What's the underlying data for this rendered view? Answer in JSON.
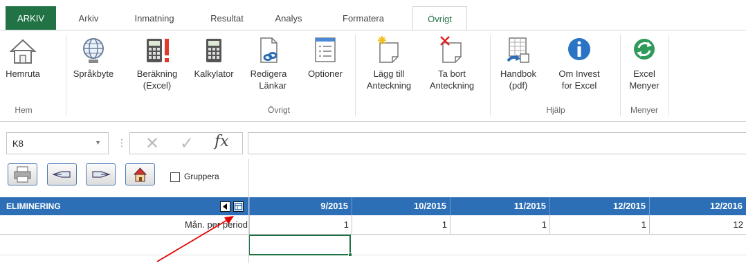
{
  "tabs": [
    "ARKIV",
    "Arkiv",
    "Inmatning",
    "Resultat",
    "Analys",
    "Formatera",
    "Övrigt"
  ],
  "ribbon": {
    "buttons": [
      {
        "line1": "Hemruta",
        "line2": ""
      },
      {
        "line1": "Språkbyte",
        "line2": ""
      },
      {
        "line1": "Beräkning",
        "line2": "(Excel)"
      },
      {
        "line1": "Kalkylator",
        "line2": ""
      },
      {
        "line1": "Redigera",
        "line2": "Länkar"
      },
      {
        "line1": "Optioner",
        "line2": ""
      },
      {
        "line1": "Lägg till",
        "line2": "Anteckning"
      },
      {
        "line1": "Ta bort",
        "line2": "Anteckning"
      },
      {
        "line1": "Handbok",
        "line2": "(pdf)"
      },
      {
        "line1": "Om Invest",
        "line2": "for Excel"
      },
      {
        "line1": "Excel",
        "line2": "Menyer"
      }
    ],
    "groups": [
      "Hem",
      "Övrigt",
      "Hjälp",
      "Menyer"
    ]
  },
  "formula_bar": {
    "name_box": "K8",
    "formula": ""
  },
  "sheet": {
    "checkbox_label": "Gruppera",
    "header_label": "ELIMINERING",
    "periods": [
      "9/2015",
      "10/2015",
      "11/2015",
      "12/2015",
      "12/2016"
    ],
    "row_label": "Mån. per period",
    "row_values": [
      "1",
      "1",
      "1",
      "1",
      "12"
    ]
  },
  "colors": {
    "file_tab": "#217346",
    "header_blue": "#2c6fb6",
    "annotation_arrow": "#e00000"
  }
}
